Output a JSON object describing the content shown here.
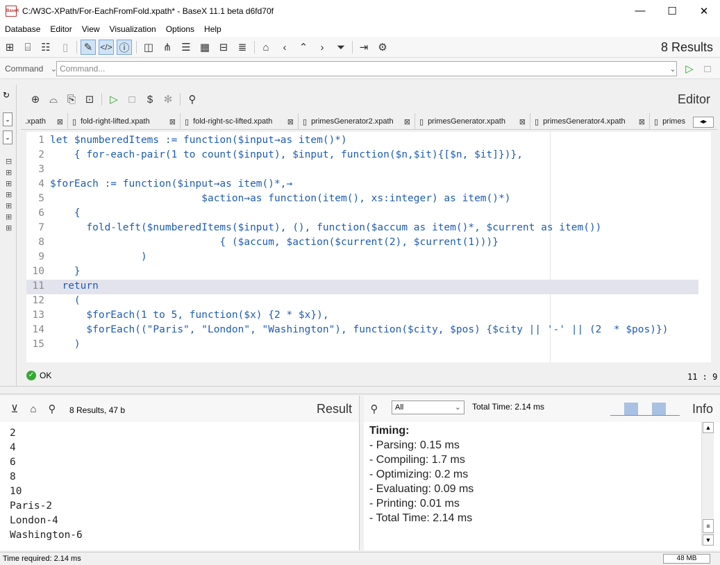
{
  "window": {
    "title": "C:/W3C-XPath/For-EachFromFold.xpath* - BaseX 11.1 beta d6fd70f",
    "minimize": "—",
    "maximize": "☐",
    "close": "✕"
  },
  "menu": [
    "Database",
    "Editor",
    "View",
    "Visualization",
    "Options",
    "Help"
  ],
  "toolbar": {
    "results": "8 Results"
  },
  "command": {
    "mode": "Command",
    "placeholder": "Command..."
  },
  "editor": {
    "label": "Editor",
    "tabs": [
      ".xpath",
      "fold-right-lifted.xpath",
      "fold-right-sc-lifted.xpath",
      "primesGenerator2.xpath",
      "primesGenerator.xpath",
      "primesGenerator4.xpath",
      "primes"
    ],
    "lines": [
      "let $numberedItems := function($input→as item()*)",
      "    { for-each-pair(1 to count($input), $input, function($n,$it){[$n, $it]})},",
      "",
      "$forEach := function($input→as item()*,→",
      "                         $action→as function(item(), xs:integer) as item()*)",
      "    {",
      "      fold-left($numberedItems($input), (), function($accum as item()*, $current as item())",
      "                            { ($accum, $action($current(2), $current(1)))}",
      "               )",
      "    }",
      "  return",
      "    (",
      "      $forEach(1 to 5, function($x) {2 * $x}),",
      "      $forEach((\"Paris\", \"London\", \"Washington\"), function($city, $pos) {$city || '-' || (2  * $pos)})",
      "    )"
    ],
    "status": "OK",
    "cursor": "11 : 9"
  },
  "result": {
    "summary": "8 Results, 47 b",
    "label": "Result",
    "lines": [
      "2",
      "4",
      "6",
      "8",
      "10",
      "Paris-2",
      "London-4",
      "Washington-6"
    ]
  },
  "info": {
    "filter": "All",
    "total": "Total Time: 2.14 ms",
    "label": "Info",
    "heading": "Timing:",
    "items": [
      "- Parsing: 0.15 ms",
      "- Compiling: 1.7 ms",
      "- Optimizing: 0.2 ms",
      "- Evaluating: 0.09 ms",
      "- Printing: 0.01 ms",
      "- Total Time: 2.14 ms"
    ]
  },
  "status": {
    "time": "Time required: 2.14 ms",
    "memory": "48 MB"
  }
}
